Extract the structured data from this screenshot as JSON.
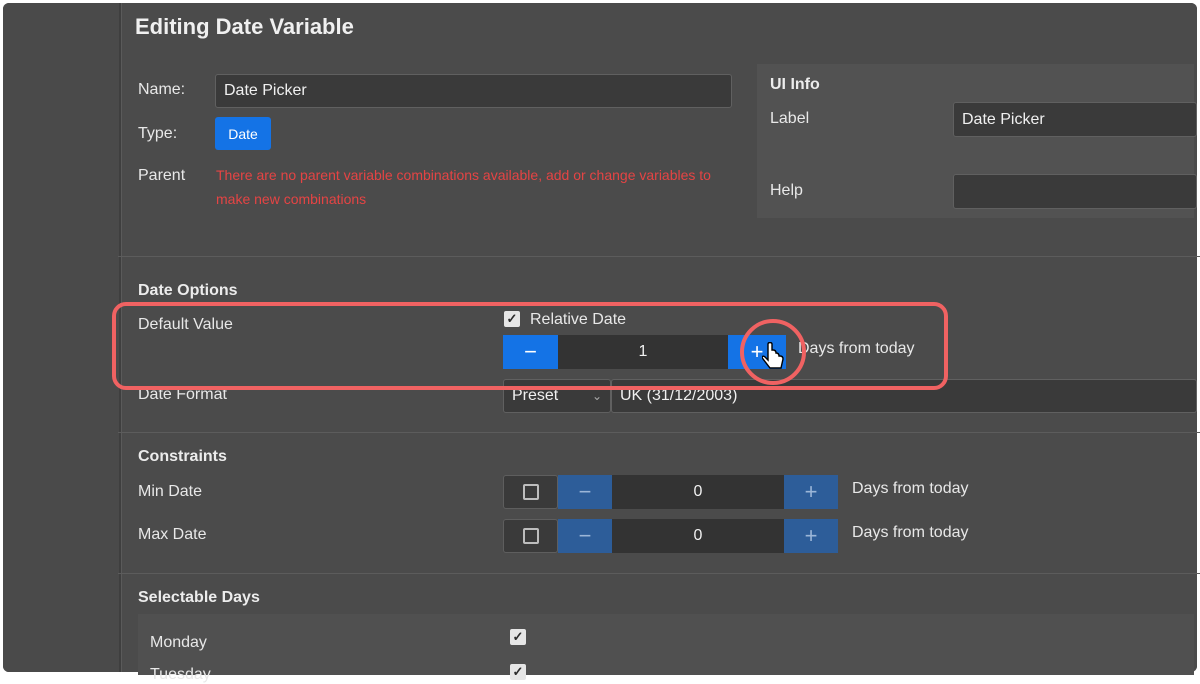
{
  "page": {
    "title": "Editing Date Variable"
  },
  "general": {
    "name_label": "Name:",
    "name_value": "Date Picker",
    "type_label": "Type:",
    "type_value": "Date",
    "parent_label": "Parent",
    "parent_error": "There are no parent variable combinations available, add or change variables to make new combinations"
  },
  "ui_info": {
    "heading": "UI Info",
    "label_label": "Label",
    "label_value": "Date Picker",
    "help_label": "Help",
    "help_value": ""
  },
  "date_options": {
    "heading": "Date Options",
    "default_value_label": "Default Value",
    "relative_date_label": "Relative Date",
    "relative_date_checked": true,
    "stepper_minus": "−",
    "stepper_value": "1",
    "stepper_plus": "+",
    "days_suffix": "Days from today",
    "date_format_label": "Date Format",
    "date_format_type": "Preset",
    "date_format_value": "UK (31/12/2003)"
  },
  "constraints": {
    "heading": "Constraints",
    "min_label": "Min Date",
    "min_value": "0",
    "min_suffix": "Days from today",
    "max_label": "Max Date",
    "max_value": "0",
    "max_suffix": "Days from today",
    "minus": "−",
    "plus": "+"
  },
  "selectable_days": {
    "heading": "Selectable Days",
    "items": [
      {
        "label": "Monday",
        "checked": true
      },
      {
        "label": "Tuesday",
        "checked": true
      }
    ]
  },
  "colors": {
    "accent": "#1473e6",
    "error": "#e54444",
    "highlight": "#f06262",
    "panel": "#4b4b4b"
  },
  "icons": {
    "cursor": "hand-pointer-icon",
    "check": "checkmark-icon"
  }
}
